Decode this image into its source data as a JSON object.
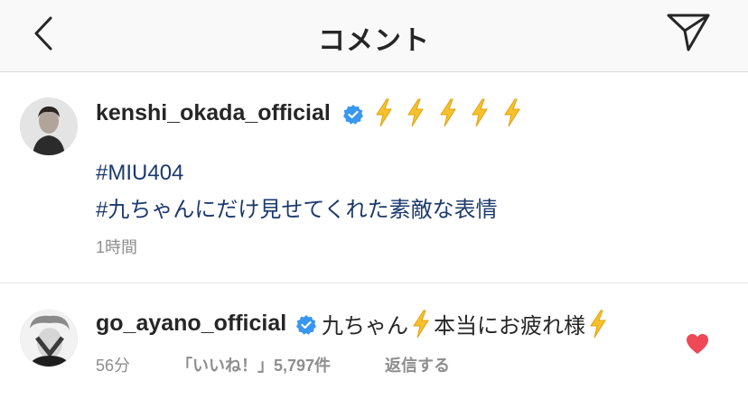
{
  "header": {
    "title": "コメント",
    "back_icon": "chevron-left-icon",
    "send_icon": "paper-plane-icon"
  },
  "caption": {
    "username": "kenshi_okada_official",
    "verified": true,
    "emoji_icons": [
      "lightning-icon",
      "lightning-icon",
      "lightning-icon",
      "lightning-icon",
      "lightning-icon"
    ],
    "hashtag1": "#MIU404",
    "hashtag2": "#九ちゃんにだけ見せてくれた素敵な表情",
    "time": "1時間"
  },
  "comment": {
    "username": "go_ayano_official",
    "verified": true,
    "text_part1": "九ちゃん",
    "text_part2": "本当にお疲れ様",
    "time": "56分",
    "likes": "「いいね！」5,797件",
    "reply_label": "返信する",
    "liked": true
  },
  "colors": {
    "header_bg": "#f9f9f9",
    "hashtag": "#1c3a6e",
    "verified_badge": "#3897f0",
    "heart": "#ed4956",
    "lightning": "#f7c12c",
    "muted_text": "#8e8e8e"
  }
}
